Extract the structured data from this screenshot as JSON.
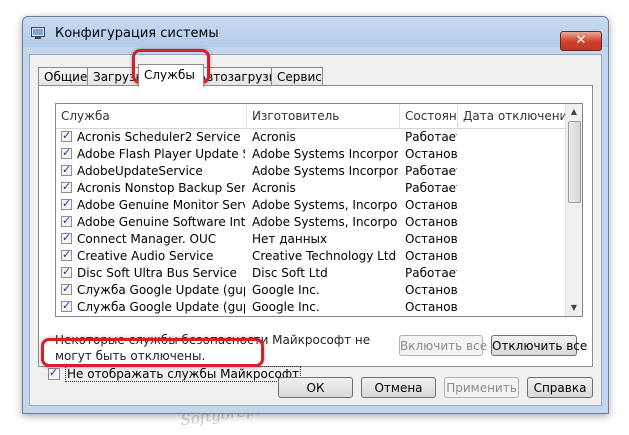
{
  "window": {
    "title": "Конфигурация системы",
    "close_glyph": "✕"
  },
  "tabs": [
    {
      "label": "Общие",
      "active": false
    },
    {
      "label": "Загрузка",
      "active": false
    },
    {
      "label": "Службы",
      "active": true
    },
    {
      "label": "Автозагрузка",
      "active": false
    },
    {
      "label": "Сервис",
      "active": false
    }
  ],
  "table": {
    "columns": [
      "Служба",
      "Изготовитель",
      "Состояние",
      "Дата отключения"
    ],
    "rows": [
      {
        "service": "Acronis Scheduler2 Service",
        "manufacturer": "Acronis",
        "status": "Работает",
        "checked": true
      },
      {
        "service": "Adobe Flash Player Update Service",
        "manufacturer": "Adobe Systems Incorporated",
        "status": "Остановлена",
        "checked": true
      },
      {
        "service": "AdobeUpdateService",
        "manufacturer": "Adobe Systems Incorporated",
        "status": "Работает",
        "checked": true
      },
      {
        "service": "Acronis Nonstop Backup Service",
        "manufacturer": "Acronis",
        "status": "Работает",
        "checked": true
      },
      {
        "service": "Adobe Genuine Monitor Service",
        "manufacturer": "Adobe Systems, Incorporated",
        "status": "Остановлена",
        "checked": true
      },
      {
        "service": "Adobe Genuine Software Integrity Service",
        "manufacturer": "Adobe Systems, Incorporated",
        "status": "Остановлена",
        "checked": true
      },
      {
        "service": "Connect Manager. OUC",
        "manufacturer": "Нет данных",
        "status": "Остановлена",
        "checked": true
      },
      {
        "service": "Creative Audio Service",
        "manufacturer": "Creative Technology Ltd",
        "status": "Остановлена",
        "checked": true
      },
      {
        "service": "Disc Soft Ultra Bus Service",
        "manufacturer": "Disc Soft Ltd",
        "status": "Работает",
        "checked": true
      },
      {
        "service": "Служба Google Update (gupdate)",
        "manufacturer": "Google Inc.",
        "status": "Остановлена",
        "checked": true
      },
      {
        "service": "Служба Google Update (gupdatem)",
        "manufacturer": "Google Inc.",
        "status": "Остановлена",
        "checked": true
      }
    ]
  },
  "note": "Некоторые службы безопасности Майкрософт не могут быть отключены.",
  "buttons": {
    "enable_all": "Включить все",
    "disable_all": "Отключить все",
    "ok": "ОК",
    "cancel": "Отмена",
    "apply": "Применить",
    "help": "Справка"
  },
  "hide_ms": {
    "label": "Не отображать службы Майкрософт",
    "checked": true
  },
  "watermark": "Softgorepair.Com",
  "colors": {
    "highlight": "#d4202a",
    "titlebar": "#b9d1ea"
  }
}
